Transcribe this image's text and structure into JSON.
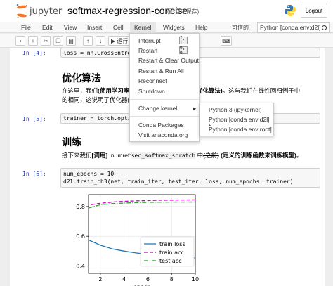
{
  "header": {
    "logo_text": "jupyter",
    "notebook_title": "softmax-regression-concise",
    "autosave": "(已自动保存)",
    "logout_label": "Logout"
  },
  "menubar": {
    "items": [
      "File",
      "Edit",
      "View",
      "Insert",
      "Cell",
      "Kernel",
      "Widgets",
      "Help"
    ],
    "active": "Kernel",
    "trusted_label": "可信的",
    "kernel_name": "Python [conda env:d2l]"
  },
  "toolbar": {
    "run_label": "运行"
  },
  "kernel_menu": {
    "items": [
      {
        "label": "Interrupt",
        "key": "I, I"
      },
      {
        "label": "Restart",
        "key": "0, 0"
      },
      {
        "label": "Restart & Clear Output"
      },
      {
        "label": "Restart & Run All"
      },
      {
        "label": "Reconnect"
      },
      {
        "label": "Shutdown"
      },
      {
        "label": "Change kernel"
      },
      {
        "label": "Conda Packages"
      },
      {
        "label": "Visit anaconda.org"
      }
    ],
    "change_kernel_arrow": "▸",
    "submenu": [
      "Python 3 (ipykernel)",
      "Python [conda env:d2l] *",
      "Python [conda env:root]"
    ]
  },
  "cells": {
    "c4_prompt": "In  [4]:",
    "c4_code": "loss = nn.CrossEntropyLo",
    "h_opt": "优化算法",
    "p_opt_1a": "在这里，我们",
    "p_opt_1b": "(使用学习率为",
    "p_opt_1c": "作为优化算法)",
    "p_opt_1d": "。这与我们在线性回归例子中",
    "p_opt_2": "的相同，这说明了优化器的",
    "c5_prompt": "In  [5]:",
    "c5_code": "trainer = torch.optim.SG",
    "h_train": "训练",
    "p_train_a": "接下来我们",
    "p_train_b": "[调用]",
    "p_train_c": " :numref:",
    "p_train_d": "sec_softmax_scratch",
    "p_train_e": " 中",
    "p_train_f": "(之前)",
    "p_train_g": " (定义的训练函数来训练模型)",
    "p_train_h": "。",
    "c6_prompt": "In  [6]:",
    "c6_line1": "num_epochs = 10",
    "c6_line2": "d2l.train_ch3(net, train_iter, test_iter, loss, num_epochs, trainer)"
  },
  "chart_data": {
    "type": "line",
    "xlabel": "epoch",
    "ylabel": "",
    "xlim": [
      1,
      10
    ],
    "ylim": [
      0.35,
      0.88
    ],
    "xticks": [
      2,
      4,
      6,
      8,
      10
    ],
    "yticks": [
      0.4,
      0.6,
      0.8
    ],
    "legend_position": "center-right",
    "series": [
      {
        "name": "train loss",
        "color": "#1f77b4",
        "dash": "solid",
        "x": [
          0.2,
          1,
          2,
          3,
          4,
          5,
          6,
          7,
          8,
          9,
          10
        ],
        "y": [
          0.85,
          0.575,
          0.54,
          0.515,
          0.5,
          0.488,
          0.478,
          0.47,
          0.463,
          0.458,
          0.454
        ]
      },
      {
        "name": "train acc",
        "color": "#bf00bf",
        "dash": "5,3",
        "x": [
          0.2,
          1,
          2,
          3,
          4,
          5,
          6,
          7,
          8,
          9,
          10
        ],
        "y": [
          0.74,
          0.81,
          0.822,
          0.83,
          0.835,
          0.838,
          0.84,
          0.842,
          0.843,
          0.844,
          0.845
        ]
      },
      {
        "name": "test acc",
        "color": "#2ca02c",
        "dash": "6,2,1,2",
        "x": [
          1,
          2,
          3,
          4,
          5,
          6,
          7,
          8,
          9,
          10
        ],
        "y": [
          0.79,
          0.812,
          0.82,
          0.823,
          0.826,
          0.828,
          0.829,
          0.83,
          0.83,
          0.83
        ]
      }
    ]
  }
}
